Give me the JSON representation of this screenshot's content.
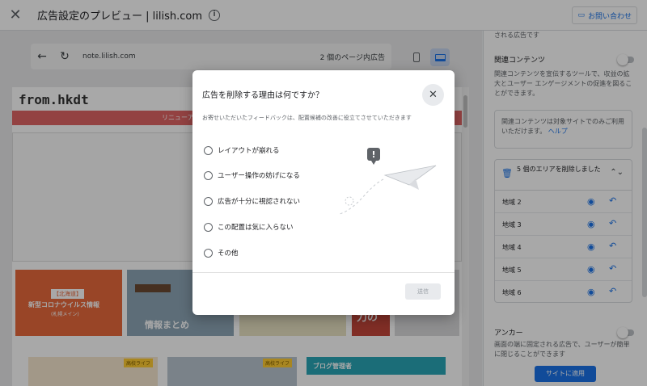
{
  "header": {
    "close_icon": "close-icon",
    "title": "広告設定のプレビュー | lilish.com",
    "contact_label": "お問い合わせ"
  },
  "browser": {
    "url": "note.lilish.com",
    "ad_count": "2 個のページ内広告"
  },
  "site": {
    "logo": "from.hkdt",
    "banner_text": "リニューアル",
    "cards": [
      {
        "tag": "【北海道】",
        "title": "新型コロナウイルス情報",
        "sub": "(札幌メイン)"
      },
      {
        "title": "情報まとめ"
      },
      {
        "title": ""
      },
      {
        "title": "力の"
      },
      {
        "title": ""
      }
    ],
    "bottom_cards": [
      {
        "label": "高校ライフ"
      },
      {
        "label": "高校ライフ"
      },
      {
        "title": "ブログ管理者"
      }
    ]
  },
  "panel": {
    "top_note": "される広告です",
    "related": {
      "title": "関連コンテンツ",
      "desc": "関連コンテンツを宣伝するツールで、収益の拡大とユーザー エンゲージメントの促進を図ることができます。",
      "note": "関連コンテンツは対象サイトでのみご利用いただけます。",
      "help": "ヘルプ"
    },
    "areas": {
      "header": "5 個のエリアを削除しました",
      "items": [
        "地域 2",
        "地域 3",
        "地域 4",
        "地域 5",
        "地域 6"
      ]
    },
    "anchor": {
      "title": "アンカー",
      "desc": "画面の端に固定される広告で、ユーザーが簡単に閉じることができます"
    },
    "apply_label": "サイトに適用"
  },
  "modal": {
    "title": "広告を削除する理由は何ですか？",
    "subtitle": "お寄せいただいたフィードバックは、配置候補の改善に役立てさせていただきます",
    "options": [
      "レイアウトが崩れる",
      "ユーザー操作の妨げになる",
      "広告が十分に視認されない",
      "この配置は気に入らない",
      "その他"
    ],
    "send_label": "送信"
  },
  "colors": {
    "accent": "#1a73e8",
    "banner": "#e06464"
  }
}
